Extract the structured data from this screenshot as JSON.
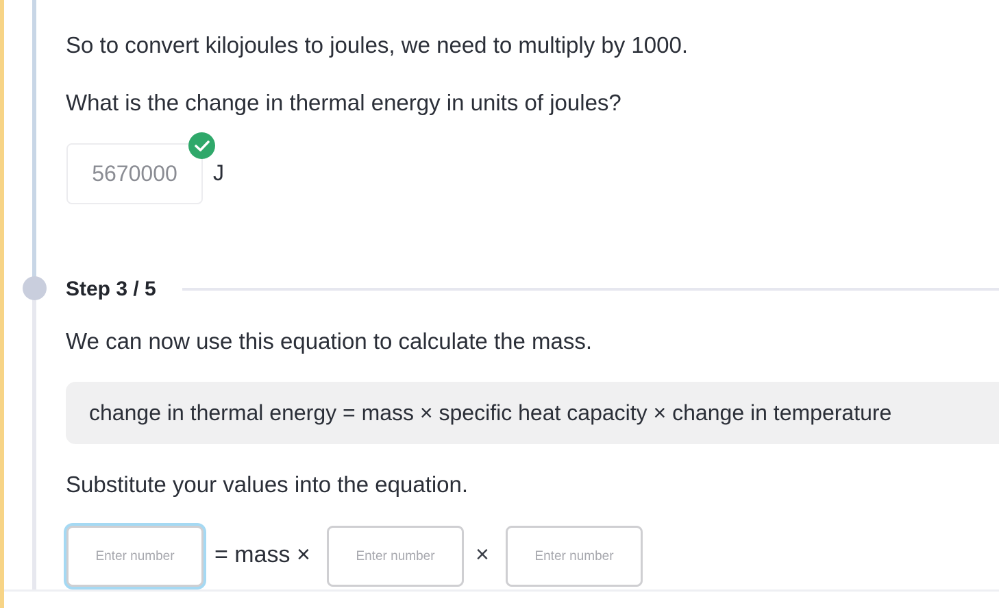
{
  "previous_step": {
    "explanation": "So to convert kilojoules to joules, we need to multiply by 1000.",
    "question": "What is the change in thermal energy in units of joules?",
    "answer_value": "5670000",
    "answer_unit": "J",
    "answer_status": "correct"
  },
  "current_step": {
    "label": "Step 3 / 5",
    "intro": "We can now use this equation to calculate the mass.",
    "equation": "change in thermal energy = mass × specific heat capacity × change in temperature",
    "instruction": "Substitute your values into the equation.",
    "inputs": [
      {
        "placeholder": "Enter number",
        "value": ""
      },
      {
        "placeholder": "Enter number",
        "value": ""
      },
      {
        "placeholder": "Enter number",
        "value": ""
      }
    ],
    "equals_mass_times": "= mass ×",
    "times": "×"
  },
  "colors": {
    "accent_left": "#f7d486",
    "success": "#2fa86a",
    "focus_ring": "#a5d9f3",
    "timeline_done": "#c8d6e6",
    "timeline_pending": "#e7e8ef"
  }
}
